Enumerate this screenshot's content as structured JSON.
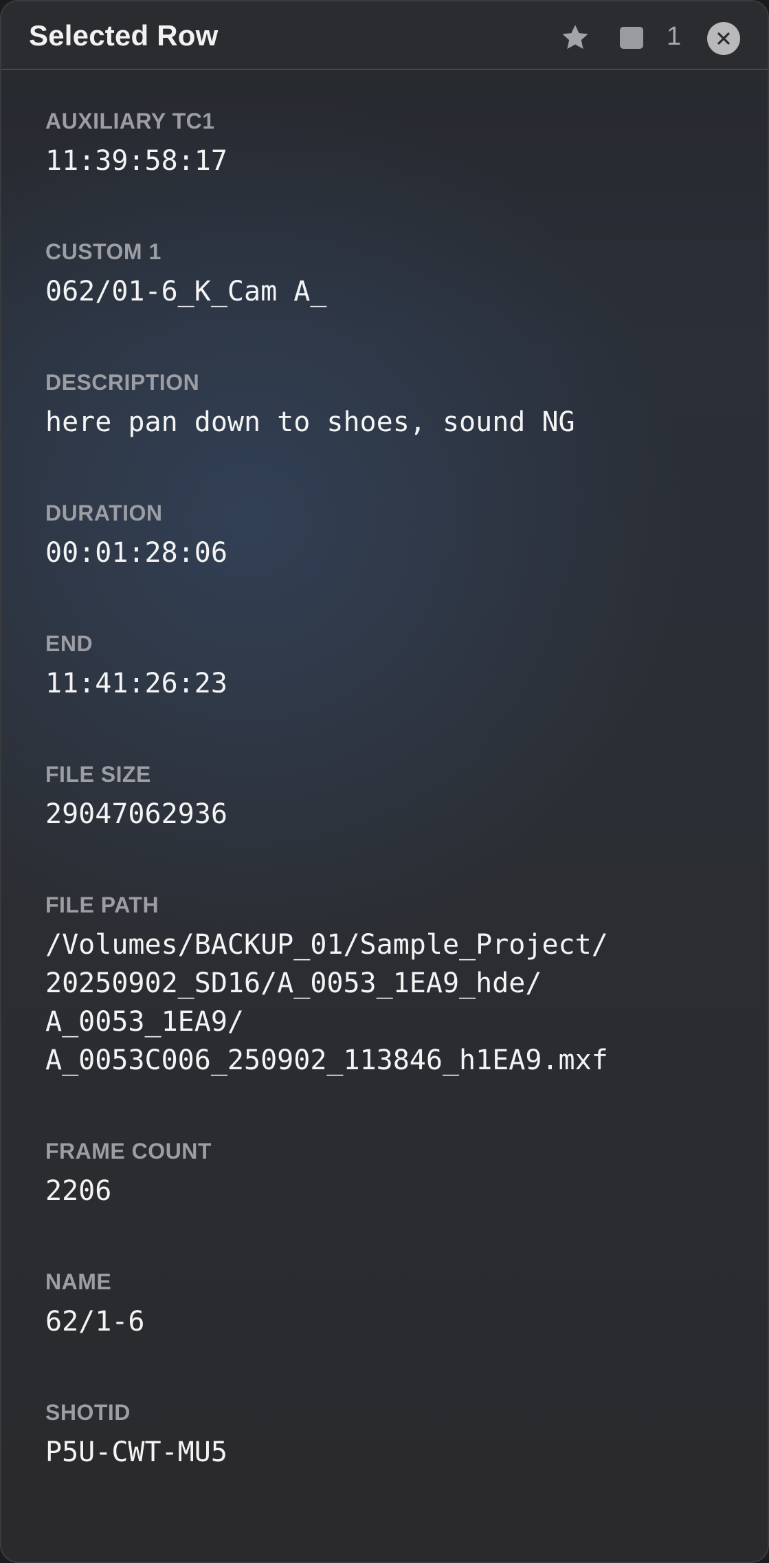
{
  "header": {
    "title": "Selected Row",
    "count": "1",
    "icons": {
      "favorite": "star-icon",
      "toggle": "square-icon",
      "close": "close-icon"
    }
  },
  "fields": [
    {
      "label": "AUXILIARY TC1",
      "value": "11:39:58:17"
    },
    {
      "label": "CUSTOM 1",
      "value": "062/01-6_K_Cam A_"
    },
    {
      "label": "DESCRIPTION",
      "value": "here pan down to shoes, sound NG"
    },
    {
      "label": "DURATION",
      "value": "00:01:28:06"
    },
    {
      "label": "END",
      "value": "11:41:26:23"
    },
    {
      "label": "FILE SIZE",
      "value": "29047062936"
    },
    {
      "label": "FILE PATH",
      "value": "/Volumes/BACKUP_01/Sample_Project/\n20250902_SD16/A_0053_1EA9_hde/\nA_0053_1EA9/\nA_0053C006_250902_113846_h1EA9.mxf"
    },
    {
      "label": "FRAME COUNT",
      "value": "2206"
    },
    {
      "label": "NAME",
      "value": "62/1-6"
    },
    {
      "label": "SHOTID",
      "value": "P5U-CWT-MU5"
    }
  ]
}
